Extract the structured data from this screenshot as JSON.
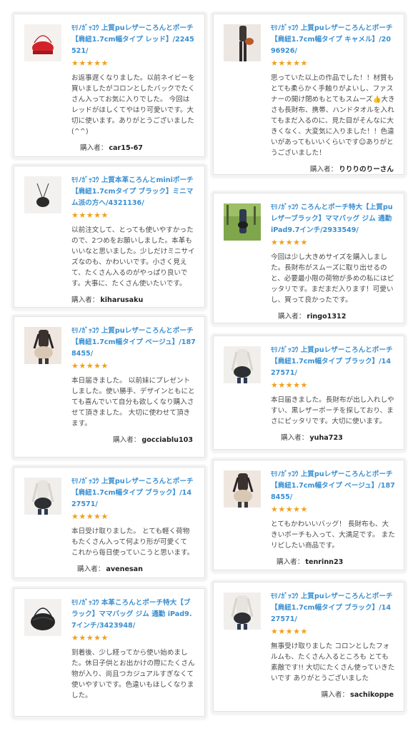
{
  "buyer_label": "購入者：",
  "star_color": "#f0a01e",
  "link_color": "#3a8fd1",
  "reviews": [
    {
      "title": "ﾓﾘﾉｶﾞｯｺｳ 上質puレザーころんとポーチ【肩紐1.7cm幅タイプ レッド】/2245521/",
      "stars": "★★★★★",
      "text": "お返事遅くなりました。以前ネイビーを買いましたがコロンとしたバックでたくさん入ってお気に入りでした。 今回はレッドがほしくてやはり可愛いです。大切に使います。ありがとうございました(^^)",
      "buyer": "car15-67",
      "thumb_icon": "red-bag-photo"
    },
    {
      "title": "ﾓﾘﾉｶﾞｯｺｳ 上質本革ころんとminiポーチ【肩紐1.7cmタイプ ブラック】ミニマム派の方へ/4321136/",
      "stars": "★★★★★",
      "text": "以前注文して、とっても使いやすかったので、2つめをお願いしました。本革もいいなと思いました。少しだけミニサイズなのも、かわいいです。小さく見えて、たくさん入るのがやっぱり良いです。大事に、たくさん使いたいです。",
      "buyer": "kiharusaku",
      "thumb_icon": "black-mini-bag-photo"
    },
    {
      "title": "ﾓﾘﾉｶﾞｯｺｳ 上質puレザーころんとポーチ【肩紐1.7cm幅タイプ ベージュ】/1878455/",
      "stars": "★★★★★",
      "text": "本日届きました。 以前妹にプレゼントしました。使い勝手、デザインともにとても喜んでいて自分も欲しくなり購入させて頂きました。 大切に使わせて頂きます。",
      "buyer": "gocciablu103",
      "thumb_icon": "beige-bag-photo"
    },
    {
      "title": "ﾓﾘﾉｶﾞｯｺｳ 上質puレザーころんとポーチ【肩紐1.7cm幅タイプ ブラック】/1427571/",
      "stars": "★★★★★",
      "text": "本日受け取りました。 とても軽く荷物もたくさん入って何より形が可愛くて これから毎日使っていこうと思います。",
      "buyer": "avenesan",
      "thumb_icon": "black-bag-photo"
    },
    {
      "title": "ﾓﾘﾉｶﾞｯｺｳ 本革ころんとポーチ特大【ブラック】ママバッグ ジム 通勤 iPad9.7インチ/3423948/",
      "stars": "★★★★★",
      "text": "到着後、少し経ってから使い始めました。休日子供とお出かけの際にたくさん物が入り、尚且つカジュアルすぎなくて使いやすいです。色違いもほしくなりました。",
      "buyer": "",
      "thumb_icon": "large-black-bag-photo"
    },
    {
      "title": "ﾓﾘﾉｶﾞｯｺｳ 上質puレザーころんとポーチ【肩紐1.7cm幅タイプ キャメル】/2096926/",
      "stars": "★★★★★",
      "text": "思っていた以上の作品でした！！材質もとても柔らかく手触りがよいし、ファスナーの開け閉めもとてもスムーズ👍大きさも長財布、携帯、ハンドタオルを入れてもまだ入るのに、見た目がそんなに大きくなく、大変気に入りました！！色違いがあってもいいくらいです☺︎ありがとうございました！",
      "buyer": "りりりのりーさん",
      "thumb_icon": "camel-bag-photo"
    },
    {
      "title": "ﾓﾘﾉｶﾞｯｺｳ ころんとポーチ特大【上質puレザーブラック】ママバッグ ジム 通勤 iPad9.7インチ/2933549/",
      "stars": "★★★★★",
      "text": "今回は少し大きめサイズを購入しました。長財布がスムーズに取り出せるのと、必要最小限の荷物が多めの私にはピッタリです。まだまだ入ります！可愛いし、買って良かったです。",
      "buyer": "ringo1312",
      "thumb_icon": "park-bag-photo"
    },
    {
      "title": "ﾓﾘﾉｶﾞｯｺｳ 上質puレザーころんとポーチ【肩紐1.7cm幅タイプ ブラック】/1427571/",
      "stars": "★★★★★",
      "text": "本日届きました。長財布が出し入れしやすい、黒レザーポーチを探しており、まさにピッタリです。大切に使います。",
      "buyer": "yuha723",
      "thumb_icon": "black-bag-photo"
    },
    {
      "title": "ﾓﾘﾉｶﾞｯｺｳ 上質puレザーころんとポーチ【肩紐1.7cm幅タイプ ベージュ】/1878455/",
      "stars": "★★★★★",
      "text": "とてもかわいいバッグ！ 長財布も、大きいポーチも入って、大満足です。 またリピしたい商品です。",
      "buyer": "tenrinn23",
      "thumb_icon": "beige-bag-photo"
    },
    {
      "title": "ﾓﾘﾉｶﾞｯｺｳ 上質puレザーころんとポーチ【肩紐1.7cm幅タイプ ブラック】/1427571/",
      "stars": "★★★★★",
      "text": "無事受け取りました コロンとしたフォルムも、たくさん入るところも とても素敵です!! 大切にたくさん使っていきたいです ありがとうございました",
      "buyer": "sachikoppe",
      "thumb_icon": "black-bag-photo"
    }
  ]
}
